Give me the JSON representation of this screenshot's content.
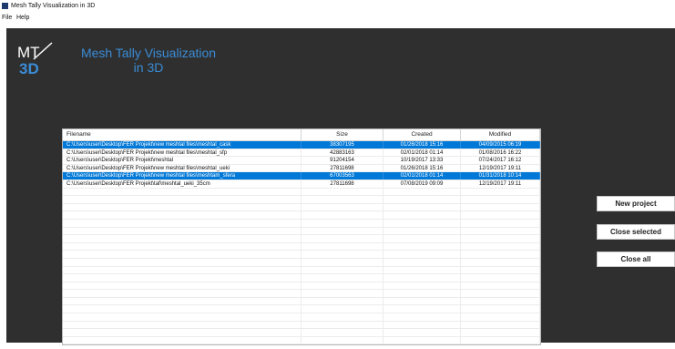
{
  "window": {
    "title": "Mesh Tally Visualization in 3D"
  },
  "menu": {
    "items": [
      "File",
      "Help"
    ]
  },
  "app": {
    "title_line1": "Mesh Tally Visualization",
    "title_line2": "in 3D",
    "logo_text_top": "MT",
    "logo_text_bottom": "3D"
  },
  "table": {
    "headers": {
      "filename": "Filename",
      "size": "Size",
      "created": "Created",
      "modified": "Modified"
    },
    "rows": [
      {
        "filename": "C:\\Users\\user\\Desktop\\FER Projekt\\new meshtal files\\meshtal_cask",
        "size": "38307195",
        "created": "01/26/2018 15:16",
        "modified": "04/09/2015 06:19",
        "selected": true
      },
      {
        "filename": "C:\\Users\\user\\Desktop\\FER Projekt\\new meshtal files\\meshtal_sfp",
        "size": "42883163",
        "created": "02/01/2018 01:14",
        "modified": "01/08/2016 16:22",
        "selected": false
      },
      {
        "filename": "C:\\Users\\user\\Desktop\\FER Projekt\\meshtal",
        "size": "91204154",
        "created": "10/19/2017 13:33",
        "modified": "07/24/2017 16:12",
        "selected": false
      },
      {
        "filename": "C:\\Users\\user\\Desktop\\FER Projekt\\new meshtal files\\meshtal_ueki",
        "size": "27811698",
        "created": "01/26/2018 15:16",
        "modified": "12/19/2017 19:11",
        "selected": false
      },
      {
        "filename": "C:\\Users\\user\\Desktop\\FER Projekt\\new meshtal files\\meshtam_sfera",
        "size": "67003563",
        "created": "02/01/2018 01:14",
        "modified": "01/31/2018 10:14",
        "selected": true
      },
      {
        "filename": "C:\\Users\\user\\Desktop\\FER Projekt\\taf\\meshtal_ueki_35cm",
        "size": "27811698",
        "created": "07/08/2019 09:09",
        "modified": "12/19/2017 19:11",
        "selected": false
      }
    ]
  },
  "buttons": {
    "new_project": "New project",
    "close_selected": "Close selected",
    "close_all": "Close all"
  },
  "colors": {
    "background": "#2f2f2f",
    "accent": "#3a8cd6",
    "selection": "#0078d7"
  }
}
